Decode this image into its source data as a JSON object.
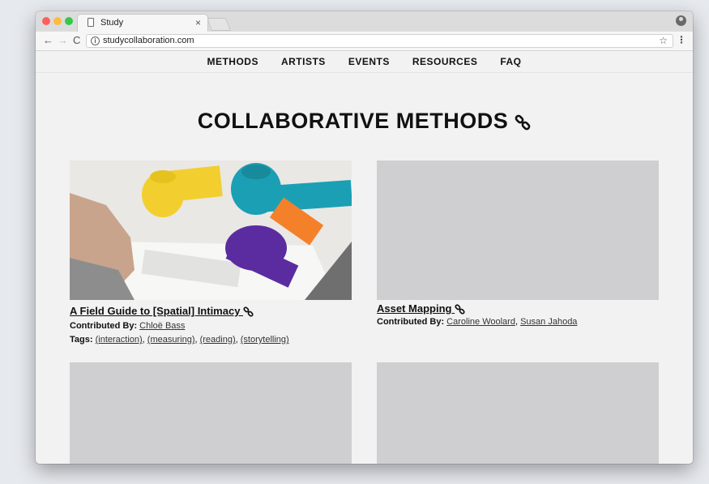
{
  "browser": {
    "tab_title": "Study",
    "tab_close": "×",
    "url": "studycollaboration.com",
    "back": "←",
    "forward": "→",
    "reload": "C",
    "star": "☆",
    "menu": "⋮",
    "info": "i"
  },
  "site_nav": [
    {
      "label": "METHODS"
    },
    {
      "label": "ARTISTS"
    },
    {
      "label": "EVENTS"
    },
    {
      "label": "RESOURCES"
    },
    {
      "label": "FAQ"
    }
  ],
  "page": {
    "title": "COLLABORATIVE METHODS"
  },
  "cards": [
    {
      "title": "A Field Guide to [Spatial] Intimacy",
      "contributed_label": "Contributed By:",
      "contributors": [
        "Chloë Bass"
      ],
      "tags_label": "Tags:",
      "tags": [
        "(interaction)",
        "(measuring)",
        "(reading)",
        "(storytelling)"
      ],
      "separator": ", "
    },
    {
      "title": "Asset Mapping",
      "contributed_label": "Contributed By:",
      "contributors": [
        "Caroline Woolard",
        "Susan Jahoda"
      ],
      "separator": ", "
    }
  ],
  "colors": {
    "ribbon_yellow": "#f2cf2e",
    "ribbon_teal": "#1b9fb4",
    "ribbon_purple": "#5b2ca0",
    "ribbon_orange": "#f5802a",
    "placeholder": "#cfcfd1"
  }
}
